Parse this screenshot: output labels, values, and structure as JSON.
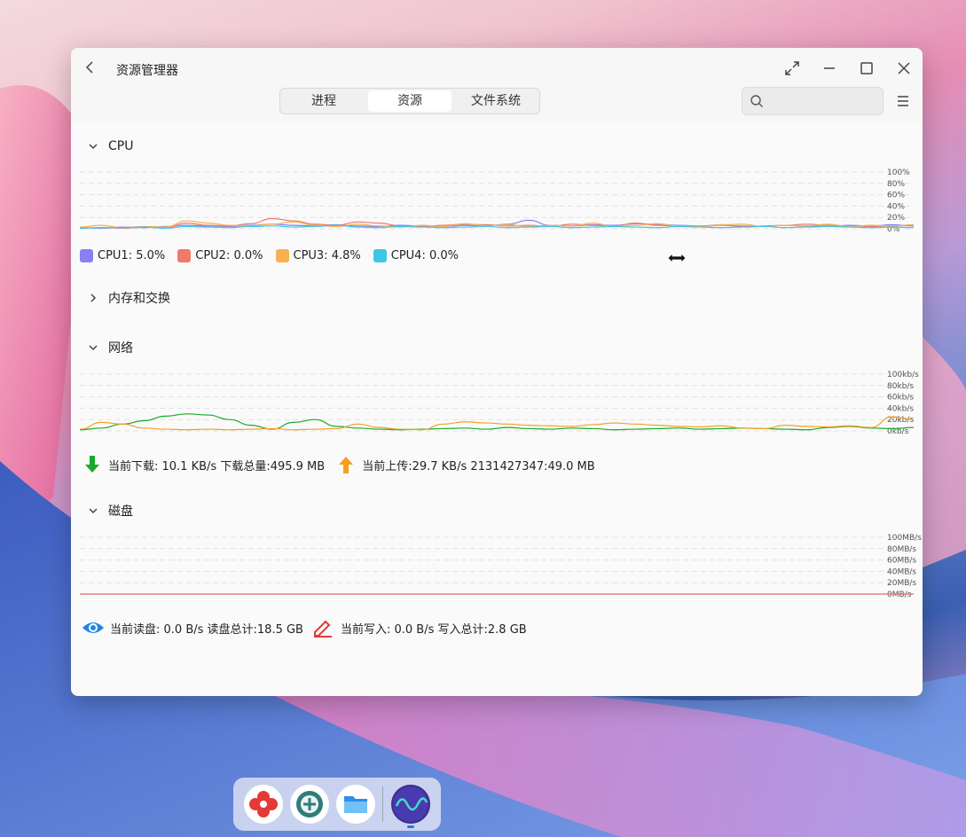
{
  "window": {
    "title": "资源管理器"
  },
  "tabs": [
    {
      "label": "进程"
    },
    {
      "label": "资源"
    },
    {
      "label": "文件系统"
    }
  ],
  "search": {
    "placeholder": ""
  },
  "sections": {
    "cpu": {
      "title": "CPU",
      "expanded": true
    },
    "memory": {
      "title": "内存和交换",
      "expanded": false
    },
    "network": {
      "title": "网络",
      "expanded": true
    },
    "disk": {
      "title": "磁盘",
      "expanded": true
    }
  },
  "cpu_legend": [
    {
      "label": "CPU1: 5.0%",
      "color": "#8a80f5"
    },
    {
      "label": "CPU2: 0.0%",
      "color": "#f07a6a"
    },
    {
      "label": "CPU3: 4.8%",
      "color": "#f9b050"
    },
    {
      "label": "CPU4: 0.0%",
      "color": "#3ec6e6"
    }
  ],
  "network": {
    "download_text": "当前下载: 10.1 KB/s 下载总量:495.9 MB",
    "upload_text": "当前上传:29.7 KB/s 2131427347:49.0 MB",
    "download_color": "#1aaa2b",
    "upload_color": "#f5a020"
  },
  "disk": {
    "read_text": "当前读盘: 0.0 B/s 读盘总计:18.5 GB",
    "write_text": "当前写入: 0.0 B/s 写入总计:2.8 GB",
    "read_icon_color": "#1e88e5",
    "write_icon_color": "#e53935"
  },
  "chart_data": [
    {
      "type": "line",
      "title": "CPU",
      "y_tick_labels": [
        "100%",
        "80%",
        "60%",
        "40%",
        "20%",
        "0%"
      ],
      "ylim": [
        0,
        100
      ],
      "grid": true,
      "series": [
        {
          "name": "CPU1",
          "color": "#8a80f5",
          "values": [
            2,
            1,
            3,
            2,
            4,
            6,
            5,
            4,
            6,
            8,
            6,
            5,
            7,
            5,
            4,
            6,
            5,
            4,
            6,
            5,
            8,
            15,
            6,
            5,
            7,
            6,
            9,
            8,
            6,
            5,
            7,
            4,
            5,
            6,
            5,
            4,
            6,
            5,
            7,
            5
          ]
        },
        {
          "name": "CPU2",
          "color": "#f07a6a",
          "values": [
            1,
            2,
            1,
            3,
            2,
            10,
            6,
            5,
            9,
            18,
            14,
            8,
            6,
            12,
            10,
            5,
            4,
            6,
            8,
            7,
            5,
            6,
            4,
            8,
            6,
            5,
            10,
            6,
            5,
            4,
            6,
            5,
            4,
            6,
            8,
            6,
            5,
            4,
            5,
            6
          ]
        },
        {
          "name": "CPU3",
          "color": "#f9b050",
          "values": [
            3,
            6,
            2,
            4,
            3,
            14,
            10,
            6,
            5,
            8,
            12,
            6,
            4,
            8,
            5,
            3,
            6,
            4,
            9,
            5,
            7,
            4,
            6,
            5,
            10,
            4,
            6,
            9,
            5,
            4,
            7,
            8,
            4,
            6,
            5,
            8,
            4,
            6,
            5,
            7
          ]
        },
        {
          "name": "CPU4",
          "color": "#3ec6e6",
          "values": [
            1,
            2,
            2,
            3,
            1,
            4,
            3,
            2,
            4,
            5,
            3,
            4,
            6,
            3,
            2,
            4,
            3,
            2,
            3,
            4,
            2,
            3,
            4,
            2,
            3,
            4,
            3,
            2,
            4,
            3,
            2,
            3,
            4,
            2,
            3,
            4,
            3,
            2,
            3,
            2
          ]
        }
      ]
    },
    {
      "type": "line",
      "title": "网络",
      "y_tick_labels": [
        "100kb/s",
        "80kb/s",
        "60kb/s",
        "40kb/s",
        "20kb/s",
        "0kb/s"
      ],
      "ylim": [
        0,
        100
      ],
      "grid": true,
      "series": [
        {
          "name": "下载",
          "color": "#1aaa2b",
          "values": [
            2,
            5,
            12,
            18,
            26,
            30,
            28,
            20,
            10,
            3,
            15,
            20,
            8,
            5,
            3,
            2,
            3,
            4,
            5,
            3,
            6,
            4,
            3,
            5,
            4,
            2,
            3,
            4,
            5,
            3,
            4,
            5,
            4,
            3,
            2,
            6,
            8,
            5,
            4,
            6
          ]
        },
        {
          "name": "上传",
          "color": "#f5a020",
          "values": [
            3,
            15,
            12,
            5,
            3,
            2,
            3,
            2,
            3,
            4,
            2,
            3,
            4,
            12,
            6,
            3,
            2,
            12,
            16,
            14,
            12,
            10,
            9,
            8,
            11,
            14,
            12,
            10,
            8,
            7,
            9,
            5,
            4,
            10,
            8,
            7,
            9,
            6,
            25,
            20
          ]
        }
      ]
    },
    {
      "type": "line",
      "title": "磁盘",
      "y_tick_labels": [
        "100MB/s",
        "80MB/s",
        "60MB/s",
        "40MB/s",
        "20MB/s",
        "0MB/s"
      ],
      "ylim": [
        0,
        100
      ],
      "grid": true,
      "series": [
        {
          "name": "读盘",
          "color": "#8a80f5",
          "values": [
            0,
            0,
            0,
            0,
            0,
            0,
            0,
            0,
            0,
            0,
            0,
            0,
            0,
            0,
            0,
            0,
            0,
            0,
            0,
            0
          ]
        },
        {
          "name": "写入",
          "color": "#f07a6a",
          "values": [
            0,
            0,
            0,
            0,
            0,
            0,
            0,
            0,
            0,
            0,
            0,
            0,
            0,
            0,
            0,
            0,
            0,
            0,
            0,
            0
          ]
        }
      ]
    }
  ],
  "dock": [
    {
      "name": "petal-app"
    },
    {
      "name": "settings-app"
    },
    {
      "name": "files-app"
    },
    {
      "name": "system-monitor-app"
    }
  ]
}
